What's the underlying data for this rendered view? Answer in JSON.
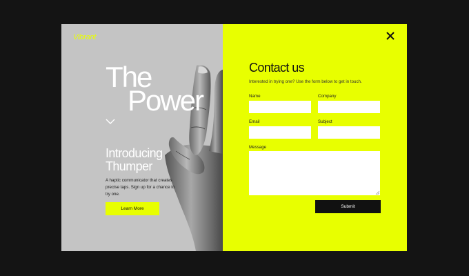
{
  "brand": {
    "logo": "Vibrant"
  },
  "hero": {
    "line1": "The",
    "line2": "Power",
    "scroll_icon": "chevron-down-icon"
  },
  "promo": {
    "title": "Introducing Thumper",
    "description": "A haptic communicator that creates precise taps. Sign up for a chance to try one.",
    "cta_label": "Learn More"
  },
  "contact": {
    "close_icon": "close-icon",
    "title": "Contact us",
    "subtitle": "Interested in trying one? Use the form below to get in touch.",
    "fields": {
      "name_label": "Name",
      "company_label": "Company",
      "email_label": "Email",
      "subject_label": "Subject",
      "message_label": "Message",
      "name_value": "",
      "company_value": "",
      "email_value": "",
      "subject_value": "",
      "message_value": ""
    },
    "submit_label": "Submit"
  },
  "colors": {
    "accent": "#e8ff00",
    "panel_gray": "#c4c4c4",
    "backdrop": "#141414",
    "dark": "#111111"
  }
}
